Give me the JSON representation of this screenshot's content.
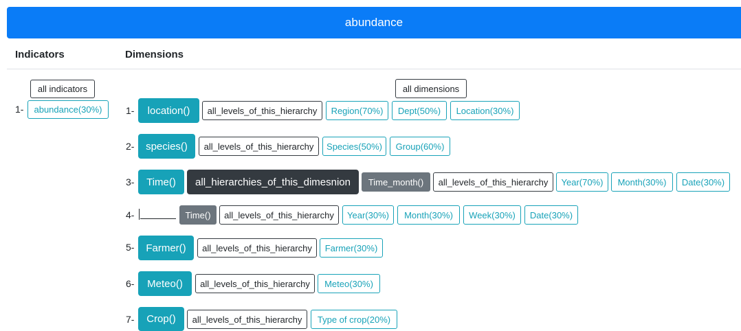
{
  "banner": {
    "title": "abundance"
  },
  "headers": {
    "indicators": "Indicators",
    "dimensions": "Dimensions"
  },
  "indicators": {
    "all_label": "all indicators",
    "items": [
      {
        "num": "1-",
        "label": "abundance(30%)"
      }
    ]
  },
  "dimensions": {
    "all_label": "all dimensions",
    "rows": [
      {
        "num": "1-",
        "name": "location()",
        "levels_label": "all_levels_of_this_hierarchy",
        "levels": [
          "Region(70%)",
          "Dept(50%)",
          "Location(30%)"
        ]
      },
      {
        "num": "2-",
        "name": "species()",
        "levels_label": "all_levels_of_this_hierarchy",
        "levels": [
          "Species(50%)",
          "Group(60%)"
        ]
      },
      {
        "num": "3-",
        "name": "Time()",
        "hierarchies_label": "all_hierarchies_of_this_dimesnion",
        "hierarchy": "Time_month()",
        "levels_label": "all_levels_of_this_hierarchy",
        "levels": [
          "Year(70%)",
          "Month(30%)",
          "Date(30%)"
        ]
      },
      {
        "num": "4-",
        "name": "Time()",
        "levels_label": "all_levels_of_this_hierarchy",
        "levels": [
          "Year(30%)",
          "Month(30%)",
          "Week(30%)",
          "Date(30%)"
        ]
      },
      {
        "num": "5-",
        "name": "Farmer()",
        "levels_label": "all_levels_of_this_hierarchy",
        "levels": [
          "Farmer(30%)"
        ]
      },
      {
        "num": "6-",
        "name": "Meteo()",
        "levels_label": "all_levels_of_this_hierarchy",
        "levels": [
          "Meteo(30%)"
        ]
      },
      {
        "num": "7-",
        "name": "Crop()",
        "levels_label": "all_levels_of_this_hierarchy",
        "levels": [
          "Type of crop(20%)"
        ]
      }
    ]
  },
  "colors": {
    "primary": "#0a7cf7",
    "info": "#17a2b8",
    "dark": "#343a40",
    "secondary": "#6c757d"
  }
}
